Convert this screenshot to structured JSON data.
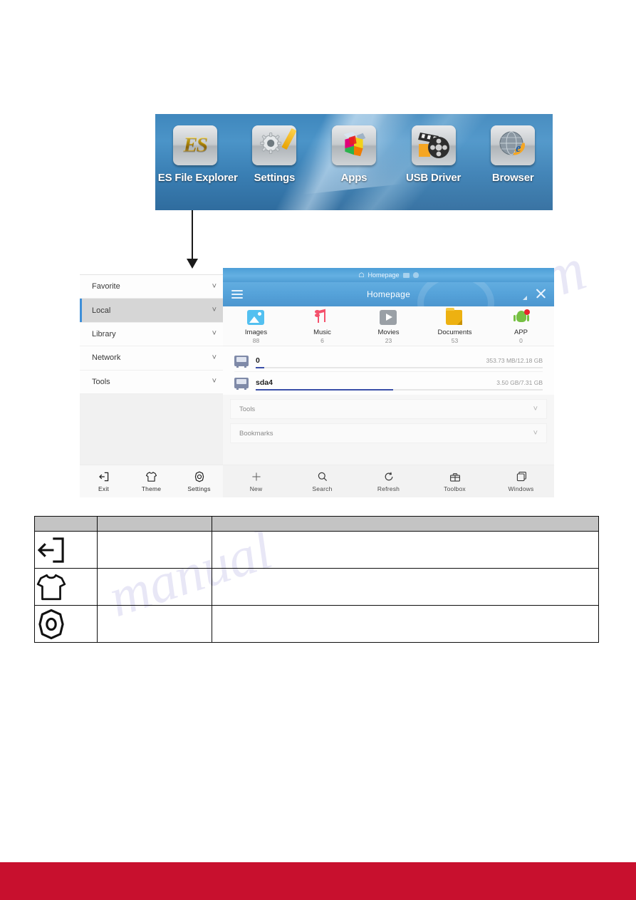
{
  "launcher": {
    "apps": [
      {
        "label": "ES File Explorer",
        "icon": "es-file-explorer-icon"
      },
      {
        "label": "Settings",
        "icon": "gear-icon"
      },
      {
        "label": "Apps",
        "icon": "cube-icon"
      },
      {
        "label": "USB Driver",
        "icon": "film-reel-icon"
      },
      {
        "label": "Browser",
        "icon": "globe-icon"
      }
    ]
  },
  "explorer": {
    "sidebar": {
      "items": [
        {
          "label": "Favorite",
          "active": false
        },
        {
          "label": "Local",
          "active": true
        },
        {
          "label": "Library",
          "active": false
        },
        {
          "label": "Network",
          "active": false
        },
        {
          "label": "Tools",
          "active": false
        }
      ],
      "chevron": "˅"
    },
    "tabbar": {
      "tab_label": "Homepage",
      "home_icon": "home-icon"
    },
    "titlebar": {
      "title": "Homepage",
      "menu_icon": "hamburger-menu-icon",
      "close_icon": "close-icon"
    },
    "categories": [
      {
        "name": "Images",
        "count": "88",
        "icon": "image-icon",
        "color": "#53c0f0"
      },
      {
        "name": "Music",
        "count": "6",
        "icon": "music-note-icon",
        "color": "#f4516c"
      },
      {
        "name": "Movies",
        "count": "23",
        "icon": "play-icon",
        "color": "#9aa0a6"
      },
      {
        "name": "Documents",
        "count": "53",
        "icon": "folder-icon",
        "color": "#edb111"
      },
      {
        "name": "APP",
        "count": "0",
        "icon": "android-icon",
        "color": "#76c043"
      }
    ],
    "storage": [
      {
        "name": "0",
        "size": "353.73 MB/12.18 GB",
        "percent": 3,
        "icon": "sd-card-icon"
      },
      {
        "name": "sda4",
        "size": "3.50 GB/7.31 GB",
        "percent": 48,
        "icon": "sd-card-icon"
      }
    ],
    "sections": [
      {
        "label": "Tools",
        "chevron": "˅"
      },
      {
        "label": "Bookmarks",
        "chevron": "˅"
      }
    ],
    "toolbar_left": [
      {
        "label": "Exit",
        "icon": "exit-icon"
      },
      {
        "label": "Theme",
        "icon": "tshirt-icon"
      },
      {
        "label": "Settings",
        "icon": "gear-hex-icon"
      }
    ],
    "toolbar_right": [
      {
        "label": "New",
        "icon": "plus-icon"
      },
      {
        "label": "Search",
        "icon": "search-icon"
      },
      {
        "label": "Refresh",
        "icon": "refresh-icon"
      },
      {
        "label": "Toolbox",
        "icon": "toolbox-icon"
      },
      {
        "label": "Windows",
        "icon": "window-icon"
      }
    ]
  },
  "legend_table": {
    "header": {
      "col1": "",
      "col2": "",
      "col3": ""
    },
    "rows": [
      {
        "icon": "exit-icon",
        "col2": "",
        "col3": ""
      },
      {
        "icon": "tshirt-icon",
        "col2": "",
        "col3": ""
      },
      {
        "icon": "gear-hex-icon",
        "col2": "",
        "col3": ""
      }
    ]
  },
  "colors": {
    "accent_blue": "#3f8fd8",
    "footer_red": "#c8102e",
    "header_gray": "#c4c4c4"
  },
  "watermark": {
    "text1": "ive.com",
    "text2": "manual"
  }
}
